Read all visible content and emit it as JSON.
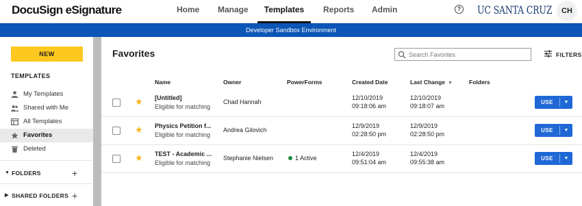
{
  "brand": "DocuSign eSignature",
  "nav": [
    {
      "label": "Home"
    },
    {
      "label": "Manage"
    },
    {
      "label": "Templates"
    },
    {
      "label": "Reports"
    },
    {
      "label": "Admin"
    }
  ],
  "header": {
    "help_icon": "help-circle-icon",
    "org_logo": "UC SANTA CRUZ",
    "avatar_initials": "CH"
  },
  "banner": "Developer Sandbox Environment",
  "sidebar": {
    "new_label": "NEW",
    "section_title": "TEMPLATES",
    "items": [
      {
        "label": "My Templates",
        "icon": "person-icon"
      },
      {
        "label": "Shared with Me",
        "icon": "people-icon"
      },
      {
        "label": "All Templates",
        "icon": "layout-icon"
      },
      {
        "label": "Favorites",
        "icon": "star-icon",
        "active": true
      },
      {
        "label": "Deleted",
        "icon": "trash-icon"
      }
    ],
    "folders_label": "FOLDERS",
    "shared_folders_label": "SHARED FOLDERS"
  },
  "main": {
    "title": "Favorites",
    "search_placeholder": "Search Favorites",
    "filters_label": "FILTERS",
    "columns": {
      "name": "Name",
      "owner": "Owner",
      "powerforms": "PowerForms",
      "created": "Created Date",
      "last_change": "Last Change",
      "folders": "Folders"
    },
    "sort_indicator": "▼",
    "rows": [
      {
        "name": "[Untitled]",
        "status": "Eligible for matching",
        "owner": "Chad Hannah",
        "powerforms": "",
        "created_date": "12/10/2019",
        "created_time": "09:18:06 am",
        "changed_date": "12/10/2019",
        "changed_time": "09:18:07 am",
        "use_label": "USE"
      },
      {
        "name": "Physics Petition f...",
        "status": "Eligible for matching",
        "owner": "Andrea Gilovich",
        "powerforms": "",
        "created_date": "12/9/2019",
        "created_time": "02:28:50 pm",
        "changed_date": "12/9/2019",
        "changed_time": "02:28:50 pm",
        "use_label": "USE"
      },
      {
        "name": "TEST - Academic ...",
        "status": "Eligible for matching",
        "owner": "Stephanie Nielsen",
        "powerforms": "1 Active",
        "created_date": "12/4/2019",
        "created_time": "09:51:04 am",
        "changed_date": "12/4/2019",
        "changed_time": "09:55:38 am",
        "use_label": "USE"
      }
    ]
  },
  "colors": {
    "accent": "#1f68d6",
    "banner": "#0b56b6",
    "new_button": "#ffc820",
    "star": "#f5b51b",
    "active_dot": "#1b8a3a"
  }
}
